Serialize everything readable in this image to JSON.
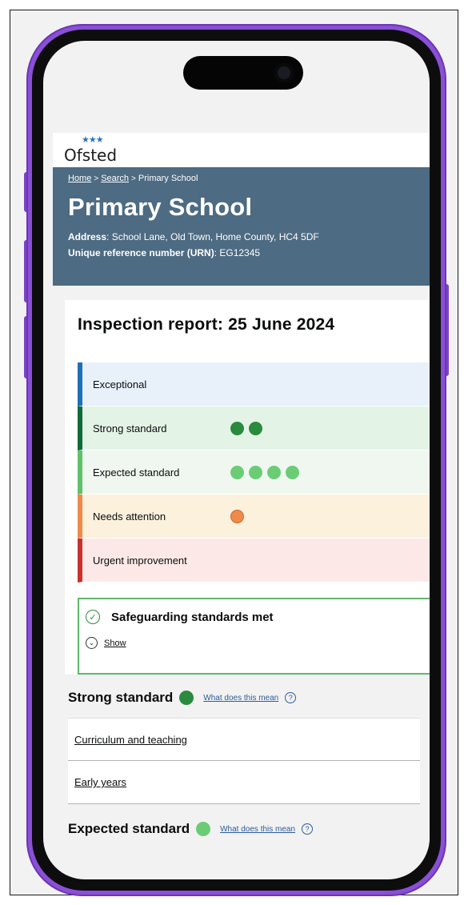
{
  "logo": {
    "stars": "★★★",
    "text": "Ofsted"
  },
  "breadcrumb": {
    "home": "Home",
    "search": "Search",
    "current": "Primary School",
    "separator": ">"
  },
  "school": {
    "title": "Primary School",
    "address_label": "Address",
    "address_value": ": School Lane, Old Town, Home County, HC4 5DF",
    "urn_label": "Unique reference number (URN)",
    "urn_value": ": EG12345"
  },
  "report": {
    "title": "Inspection report: 25 June 2024",
    "grades": [
      {
        "label": "Exceptional",
        "count": 0
      },
      {
        "label": "Strong standard",
        "count": 2
      },
      {
        "label": "Expected standard",
        "count": 4
      },
      {
        "label": "Needs attention",
        "count": 1
      },
      {
        "label": "Urgent improvement",
        "count": 0
      }
    ]
  },
  "safeguarding": {
    "title": "Safeguarding standards met",
    "show_label": "Show"
  },
  "strong_section": {
    "title": "Strong standard",
    "help_link": "What does this mean",
    "items": [
      "Curriculum and teaching",
      "Early years"
    ]
  },
  "expected_section": {
    "title": "Expected standard",
    "help_link": "What does this mean"
  },
  "colors": {
    "exceptional": "#1d70b8",
    "strong": "#0f6b3a",
    "strong_dot": "#2a8a3e",
    "expected": "#5fc26b",
    "needs_attention": "#f08a4b",
    "urgent": "#c9302c",
    "header_bg": "#4d6b82",
    "phone_frame": "#8a4fd6"
  }
}
